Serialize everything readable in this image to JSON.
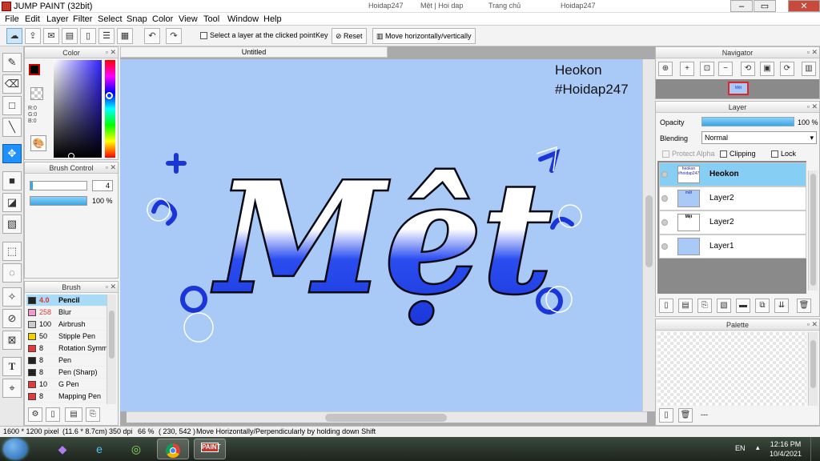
{
  "window": {
    "title": "JUMP PAINT (32bit)",
    "minimize": "–",
    "maximize": "▭",
    "close": "✕"
  },
  "browser_tabs": [
    "Hoidap247",
    "Mệt | Hoi dap",
    "Trang chủ",
    "Hoidap247"
  ],
  "menu": [
    "File",
    "Edit",
    "Layer",
    "Filter",
    "Select",
    "Snap",
    "Color",
    "View",
    "Tool",
    "Window",
    "Help"
  ],
  "toolbar": {
    "select_layer_label": "Select a layer at the clicked point",
    "key_label": "Key",
    "reset_label": "Reset",
    "move_label": "Move horizontally/vertically"
  },
  "color_panel": {
    "title": "Color",
    "r": "R:0",
    "g": "G:0",
    "b": "B:0",
    "fg": "#000000",
    "bg": "#ffffff"
  },
  "brush_control": {
    "title": "Brush Control",
    "size": "4",
    "opacity": "100 %"
  },
  "brush_panel": {
    "title": "Brush",
    "items": [
      {
        "size": "4.0",
        "name": "Pencil",
        "color": "#222222"
      },
      {
        "size": "258",
        "name": "Blur",
        "color": "#f09acb"
      },
      {
        "size": "100",
        "name": "Airbrush",
        "color": "#cccccc"
      },
      {
        "size": "50",
        "name": "Stipple Pen",
        "color": "#f1d000"
      },
      {
        "size": "8",
        "name": "Rotation Symm",
        "color": "#e13a3a"
      },
      {
        "size": "8",
        "name": "Pen",
        "color": "#222222"
      },
      {
        "size": "8",
        "name": "Pen (Sharp)",
        "color": "#222222"
      },
      {
        "size": "10",
        "name": "G Pen",
        "color": "#e13a3a"
      },
      {
        "size": "8",
        "name": "Mapping Pen",
        "color": "#e13a3a"
      }
    ]
  },
  "document": {
    "tab": "Untitled",
    "text_line1": "Heokon",
    "text_line2": "#Hoidap247",
    "art_text": "Mệt"
  },
  "navigator": {
    "title": "Navigator"
  },
  "layer_panel": {
    "title": "Layer",
    "opacity_label": "Opacity",
    "opacity_value": "100 %",
    "blending_label": "Blending",
    "blending_value": "Normal",
    "protect_alpha": "Protect Alpha",
    "clipping": "Clipping",
    "lock": "Lock",
    "layers": [
      {
        "name": "Heokon",
        "thumb": "heokon #hoidap247",
        "selected": true
      },
      {
        "name": "Layer2",
        "thumb": "mệt",
        "selected": false
      },
      {
        "name": "Layer2",
        "thumb": "Mệt",
        "selected": false
      },
      {
        "name": "Layer1",
        "thumb": "",
        "selected": false
      }
    ]
  },
  "palette_panel": {
    "title": "Palette",
    "dashes": "---"
  },
  "status": {
    "size": "1600 * 1200 pixel",
    "dims": "(11.6 * 8.7cm)",
    "dpi": "350 dpi",
    "zoom": "66 %",
    "coords": "( 230, 542 )",
    "hint": "Move Horizontally/Perpendicularly by holding down Shift"
  },
  "taskbar": {
    "lang": "EN",
    "time": "12:16 PM",
    "date": "10/4/2021",
    "paint_label": "PAINT"
  }
}
